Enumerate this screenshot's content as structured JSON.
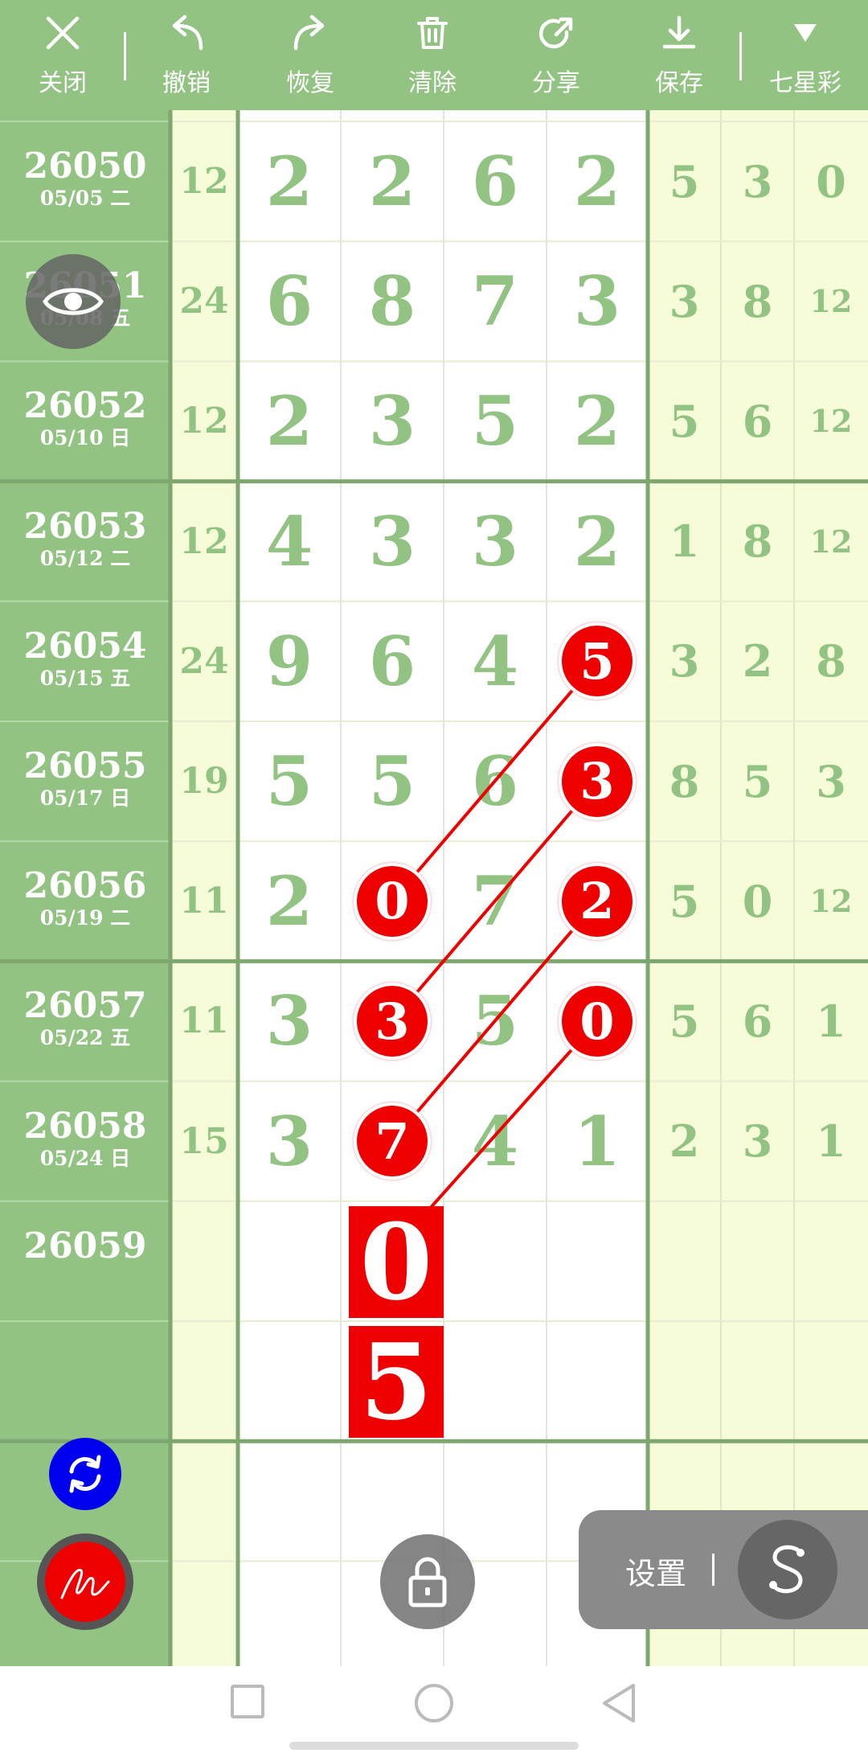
{
  "toolbar": {
    "close_label": "关闭",
    "undo_label": "撤销",
    "redo_label": "恢复",
    "clear_label": "清除",
    "share_label": "分享",
    "save_label": "保存",
    "lottery_label": "七星彩"
  },
  "rows": [
    {
      "issue": "26050",
      "date": "05/05 二",
      "sum": "12",
      "main": [
        "2",
        "2",
        "6",
        "2"
      ],
      "rest": [
        "5",
        "3",
        "0"
      ]
    },
    {
      "issue": "26051",
      "date": "05/08 五",
      "sum": "24",
      "main": [
        "6",
        "8",
        "7",
        "3"
      ],
      "rest": [
        "3",
        "8",
        "12"
      ]
    },
    {
      "issue": "26052",
      "date": "05/10 日",
      "sum": "12",
      "main": [
        "2",
        "3",
        "5",
        "2"
      ],
      "rest": [
        "5",
        "6",
        "12"
      ]
    },
    {
      "issue": "26053",
      "date": "05/12 二",
      "sum": "12",
      "main": [
        "4",
        "3",
        "3",
        "2"
      ],
      "rest": [
        "1",
        "8",
        "12"
      ]
    },
    {
      "issue": "26054",
      "date": "05/15 五",
      "sum": "24",
      "main": [
        "9",
        "6",
        "4",
        "5"
      ],
      "rest": [
        "3",
        "2",
        "8"
      ]
    },
    {
      "issue": "26055",
      "date": "05/17 日",
      "sum": "19",
      "main": [
        "5",
        "5",
        "6",
        "3"
      ],
      "rest": [
        "8",
        "5",
        "3"
      ]
    },
    {
      "issue": "26056",
      "date": "05/19 二",
      "sum": "11",
      "main": [
        "2",
        "0",
        "7",
        "2"
      ],
      "rest": [
        "5",
        "0",
        "12"
      ]
    },
    {
      "issue": "26057",
      "date": "05/22 五",
      "sum": "11",
      "main": [
        "3",
        "3",
        "5",
        "0"
      ],
      "rest": [
        "5",
        "6",
        "1"
      ]
    },
    {
      "issue": "26058",
      "date": "05/24 日",
      "sum": "15",
      "main": [
        "3",
        "7",
        "4",
        "1"
      ],
      "rest": [
        "2",
        "3",
        "1"
      ]
    },
    {
      "issue": "26059",
      "date": "",
      "sum": "",
      "main": [
        "",
        "",
        "",
        ""
      ],
      "rest": [
        "",
        "",
        ""
      ]
    },
    {
      "issue": "",
      "date": "",
      "sum": "",
      "main": [
        "",
        "",
        "",
        ""
      ],
      "rest": [
        "",
        "",
        ""
      ]
    }
  ],
  "highlights": [
    {
      "row": 4,
      "col": 3
    },
    {
      "row": 5,
      "col": 3
    },
    {
      "row": 6,
      "col": 1
    },
    {
      "row": 6,
      "col": 3
    },
    {
      "row": 7,
      "col": 1
    },
    {
      "row": 7,
      "col": 3
    },
    {
      "row": 8,
      "col": 1
    }
  ],
  "prediction": {
    "row": 9,
    "col": 1,
    "values": [
      "0",
      "5"
    ]
  },
  "settings_label": "设置",
  "colors": {
    "toolbar": "#93c383",
    "issue_col": "#93c383",
    "digit": "#93c383",
    "side_bg": "#f6fbd8",
    "highlight": "#ee0000"
  },
  "icons": {
    "eye": "eye-icon",
    "refresh": "refresh-icon",
    "pen": "signature-icon",
    "lock": "lock-icon",
    "s": "s-logo-icon"
  }
}
